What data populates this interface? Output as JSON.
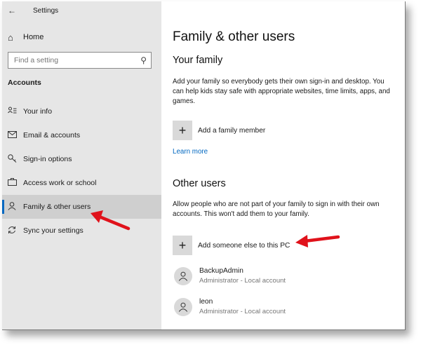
{
  "window": {
    "title": "Settings"
  },
  "sidebar": {
    "home_label": "Home",
    "search_placeholder": "Find a setting",
    "section_label": "Accounts",
    "items": [
      {
        "label": "Your info",
        "icon": "person-card-icon"
      },
      {
        "label": "Email & accounts",
        "icon": "mail-icon"
      },
      {
        "label": "Sign-in options",
        "icon": "key-icon"
      },
      {
        "label": "Access work or school",
        "icon": "briefcase-icon"
      },
      {
        "label": "Family & other users",
        "icon": "person-icon",
        "active": true
      },
      {
        "label": "Sync your settings",
        "icon": "sync-icon"
      }
    ]
  },
  "main": {
    "page_title": "Family & other users",
    "your_family": {
      "heading": "Your family",
      "description": "Add your family so everybody gets their own sign-in and desktop. You can help kids stay safe with appropriate websites, time limits, apps, and games.",
      "add_label": "Add a family member",
      "learn_more": "Learn more"
    },
    "other_users": {
      "heading": "Other users",
      "description": "Allow people who are not part of your family to sign in with their own accounts. This won't add them to your family.",
      "add_label": "Add someone else to this PC",
      "users": [
        {
          "name": "BackupAdmin",
          "role": "Administrator - Local account"
        },
        {
          "name": "leon",
          "role": "Administrator - Local account"
        }
      ]
    }
  },
  "colors": {
    "accent": "#0067c0",
    "annotation_arrow": "#e0121b",
    "sidebar_bg": "#e6e6e6"
  }
}
